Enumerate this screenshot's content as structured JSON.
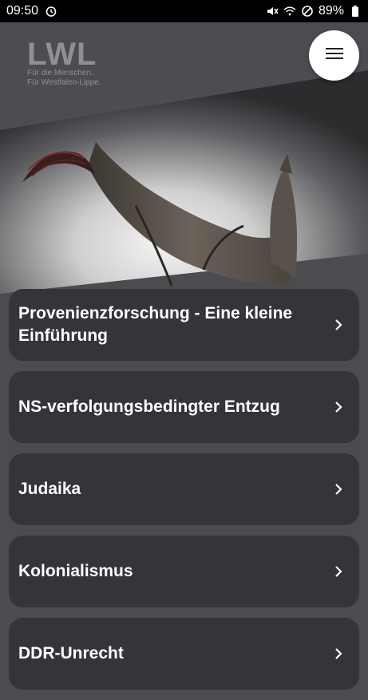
{
  "status": {
    "time": "09:50",
    "battery": "89%",
    "icons": [
      "timer-icon",
      "mute-icon",
      "wifi-icon",
      "do-not-disturb-icon",
      "battery-icon"
    ]
  },
  "logo": {
    "mark": "LWL",
    "line1": "Für die Menschen.",
    "line2": "Für Westfalen-Lippe."
  },
  "menu": {
    "icon": "hamburger-menu-icon"
  },
  "items": [
    {
      "label": "Provenienzforschung - Eine kleine Einführung"
    },
    {
      "label": "NS-verfolgungsbedingter Entzug"
    },
    {
      "label": "Judaika"
    },
    {
      "label": "Kolonialismus"
    },
    {
      "label": "DDR-Unrecht"
    }
  ],
  "colors": {
    "background": "#4a4c50",
    "card": "#333538",
    "text": "#ffffff"
  }
}
